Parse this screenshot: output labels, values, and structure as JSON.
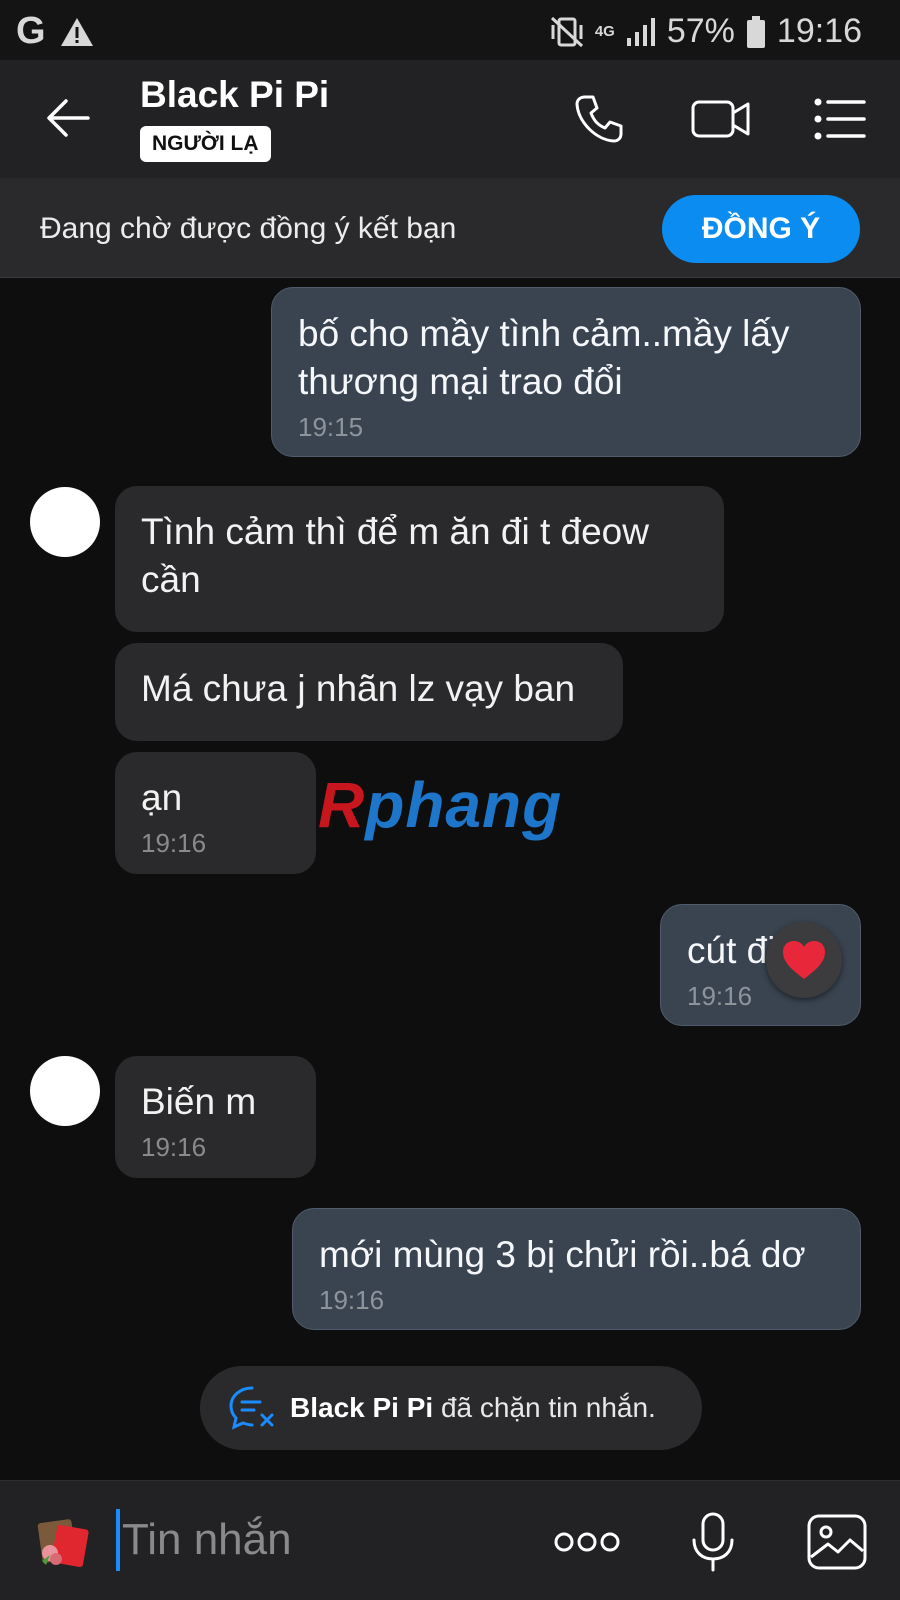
{
  "status_bar": {
    "left_glyph": "G",
    "battery": "57%",
    "network": "4G",
    "time": "19:16",
    "icons": [
      "g-icon",
      "warning-icon",
      "vibrate-icon",
      "signal-icon",
      "battery-icon"
    ]
  },
  "header": {
    "title": "Black Pi Pi",
    "badge": "NGƯỜI LẠ",
    "icons": [
      "back-arrow-icon",
      "phone-icon",
      "video-icon",
      "menu-icon"
    ]
  },
  "friend_request": {
    "text": "Đang chờ được đồng ý kết bạn",
    "button": "ĐỒNG Ý"
  },
  "messages": [
    {
      "dir": "out",
      "text": "bố cho mầy tình cảm..mầy lấy thương mại trao đổi",
      "time": "19:15"
    },
    {
      "dir": "in",
      "text": "Tình cảm thì để m ăn đi t đeow cần",
      "time": ""
    },
    {
      "dir": "in",
      "text": "Má chưa j nhãn lz vạy ban",
      "time": ""
    },
    {
      "dir": "in",
      "text": "ạn",
      "time": "19:16"
    },
    {
      "dir": "out",
      "text": "cút đi",
      "time": "19:16",
      "reaction": "heart-icon"
    },
    {
      "dir": "in",
      "text": "Biến m",
      "time": "19:16"
    },
    {
      "dir": "out",
      "text": "mới mùng 3 bị chửi rồi..bá dơ",
      "time": "19:16"
    }
  ],
  "watermark": {
    "first": "R",
    "rest": "phang"
  },
  "system_notice": {
    "name": "Black Pi Pi",
    "text": "đã chặn tin nhắn."
  },
  "composer": {
    "placeholder": "Tin nhắn",
    "icons": [
      "sticker-icon",
      "more-icon",
      "microphone-icon",
      "image-icon"
    ]
  },
  "colors": {
    "accent": "#0a8cf0",
    "outgoing_bubble": "#394450",
    "incoming_bubble": "#2a2a2c",
    "background": "#0e0e0f"
  }
}
